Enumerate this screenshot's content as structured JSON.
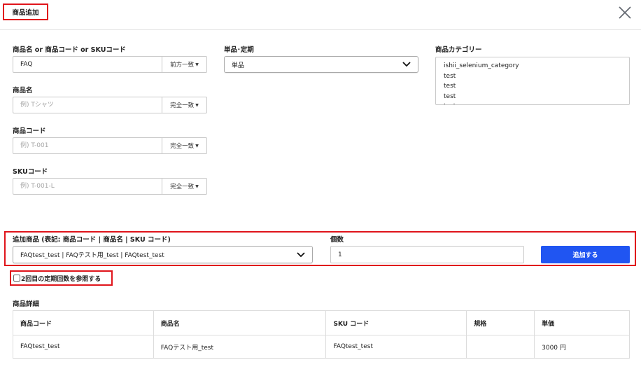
{
  "modal": {
    "title": "商品追加"
  },
  "search": {
    "combined": {
      "label": "商品名 or 商品コード or SKUコード",
      "value": "FAQ",
      "match": "前方一致"
    },
    "name": {
      "label": "商品名",
      "placeholder": "例) Tシャツ",
      "match": "完全一致"
    },
    "code": {
      "label": "商品コード",
      "placeholder": "例) T-001",
      "match": "完全一致"
    },
    "sku": {
      "label": "SKUコード",
      "placeholder": "例) T-001-L",
      "match": "完全一致"
    }
  },
  "type_filter": {
    "label": "単品･定期",
    "selected": "単品"
  },
  "category": {
    "label": "商品カテゴリー",
    "options": [
      "ishii_selenium_category",
      "test",
      "test",
      "test",
      "test"
    ]
  },
  "add_product": {
    "label": "追加商品 (表記: 商品コード | 商品名 | SKU コード)",
    "selected": "FAQtest_test | FAQテスト用_test | FAQtest_test",
    "qty_label": "個数",
    "qty_value": "1",
    "button": "追加する"
  },
  "recurring_checkbox_label": "2回目の定期回数を参照する",
  "details": {
    "title": "商品詳細",
    "columns": [
      "商品コード",
      "商品名",
      "SKU コード",
      "規格",
      "単価"
    ],
    "rows": [
      [
        "FAQtest_test",
        "FAQテスト用_test",
        "FAQtest_test",
        "",
        "3000 円"
      ]
    ]
  },
  "colors": {
    "primary": "#2055f2",
    "highlight": "#e0141b"
  },
  "icons": {
    "close": "close-icon",
    "dropdown": "chevron-down-icon",
    "caret": "caret-down-icon"
  }
}
